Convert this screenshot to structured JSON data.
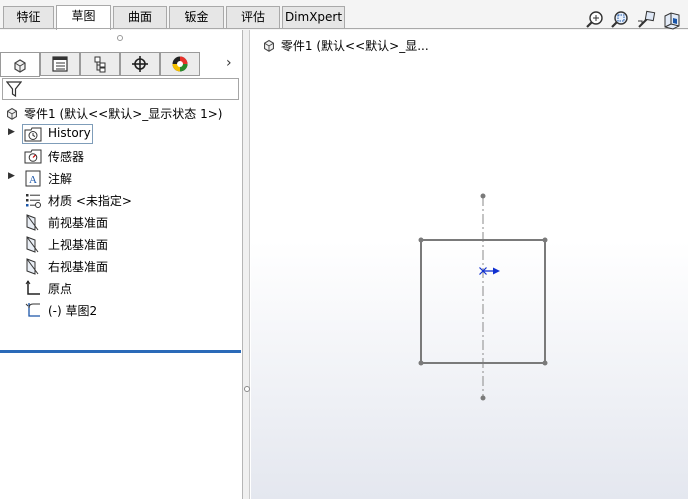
{
  "ribbon": {
    "tabs": [
      "特征",
      "草图",
      "曲面",
      "钣金",
      "评估",
      "DimXpert"
    ],
    "active_tab": "草图"
  },
  "manager": {
    "tabs": [
      "featuremanager-tree",
      "property-manager",
      "configuration-manager",
      "dimxpert-manager",
      "display-manager"
    ],
    "more": "›"
  },
  "tree": {
    "root": "零件1  (默认<<默认>_显示状态 1>)",
    "items": [
      {
        "label": "History",
        "icon": "history-icon",
        "expandable": true
      },
      {
        "label": "传感器",
        "icon": "sensor-icon",
        "expandable": false
      },
      {
        "label": "注解",
        "icon": "annotation-icon",
        "expandable": true
      },
      {
        "label": "材质 <未指定>",
        "icon": "material-icon",
        "expandable": false
      },
      {
        "label": "前视基准面",
        "icon": "plane-icon",
        "expandable": false
      },
      {
        "label": "上视基准面",
        "icon": "plane-icon",
        "expandable": false
      },
      {
        "label": "右视基准面",
        "icon": "plane-icon",
        "expandable": false
      },
      {
        "label": "原点",
        "icon": "origin-icon",
        "expandable": false
      },
      {
        "label": "(-) 草图2",
        "icon": "sketch-icon",
        "expandable": false
      }
    ]
  },
  "flyout": {
    "label": "零件1  (默认<<默认>_显..."
  },
  "heads_up": [
    "zoom-to-fit-icon",
    "zoom-to-area-icon",
    "previous-view-icon",
    "section-view-icon"
  ],
  "colors": {
    "sketch_line": "#7a7a7a",
    "origin_arrow": "#1030d0",
    "rollback_bar": "#2a6ab8"
  }
}
